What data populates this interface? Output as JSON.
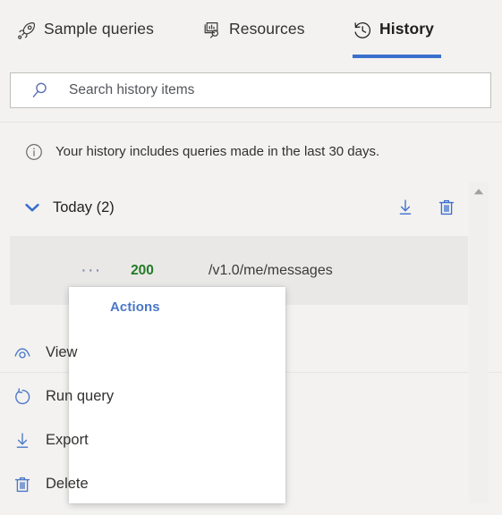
{
  "tabs": [
    {
      "id": "sample",
      "label": "Sample queries",
      "icon": "rocket-icon",
      "active": false
    },
    {
      "id": "resources",
      "label": "Resources",
      "icon": "resources-icon",
      "active": false
    },
    {
      "id": "history",
      "label": "History",
      "icon": "history-clock-icon",
      "active": true
    }
  ],
  "search": {
    "placeholder": "Search history items",
    "value": "",
    "icon": "search-icon"
  },
  "info": {
    "icon": "info-circle-icon",
    "message": "Your history includes queries made in the last 30 days."
  },
  "group": {
    "title": "Today (2)",
    "chevron": "chevron-down-icon",
    "actions": [
      {
        "name": "download-icon",
        "label": "Export"
      },
      {
        "name": "trash-icon",
        "label": "Delete"
      }
    ]
  },
  "rows": [
    {
      "ellipsis": "···",
      "status": "200",
      "status_color": "#237b25",
      "path": "/v1.0/me/messages"
    }
  ],
  "context_menu": {
    "header": "Actions",
    "items": [
      {
        "label": "View",
        "icon": "eye-icon"
      },
      {
        "label": "Run query",
        "icon": "refresh-icon"
      },
      {
        "label": "Export",
        "icon": "download-icon"
      },
      {
        "label": "Delete",
        "icon": "trash-icon"
      }
    ]
  },
  "colors": {
    "accent": "#3b6fcc",
    "menu_header": "#4a77c6",
    "status_success": "#237b25",
    "page_background": "#f3f2f1",
    "row_selected": "#e9e8e7"
  },
  "scrollbar": {
    "arrow": "scroll-up-arrow-icon"
  }
}
